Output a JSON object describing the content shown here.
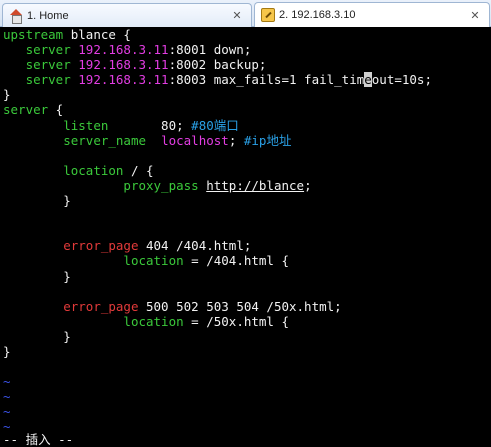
{
  "tabs": {
    "home": {
      "label": "1. Home",
      "icon": "home-icon"
    },
    "active": {
      "label": "2. 192.168.3.10",
      "icon": "key-icon"
    },
    "close_glyph": "✕"
  },
  "editor": {
    "upstream_kw": "upstream",
    "upstream_name": " blance {",
    "servers": [
      {
        "kw": "server",
        "ip": "192.168.3.11",
        "rest": ":8001 down;"
      },
      {
        "kw": "server",
        "ip": "192.168.3.11",
        "rest": ":8002 backup;"
      },
      {
        "kw": "server",
        "ip": "192.168.3.11",
        "rest_a": ":8003 max_fails=1 fail_tim",
        "cursor": "e",
        "rest_b": "out=10s;"
      }
    ],
    "close_brace": "}",
    "server_kw": "server",
    "server_open": " {",
    "listen_kw": "listen",
    "listen_value": "       80; ",
    "listen_comment": "#80端口",
    "server_name_kw": "server_name",
    "server_name_value": "localhost",
    "server_name_semicolon": "; ",
    "server_name_comment": "#ip地址",
    "location_kw": "location",
    "location_path": " / {",
    "proxy_pass_kw": "proxy_pass",
    "proxy_pass_url": "http://blance",
    "semicolon": ";",
    "inner_close": "}",
    "error_page_kw": "error_page",
    "error_404_args": " 404 /404.html;",
    "location_404": " = /404.html {",
    "error_50x_args": " 500 502 503 504 /50x.html;",
    "location_50x": " = /50x.html {",
    "tilde": "~",
    "mode_line": "-- 插入 --"
  },
  "colors": {
    "keyword": "#3bc93b",
    "ip": "#e23de2",
    "comment": "#2aa0e6",
    "error_kw": "#e23a3a",
    "tilde": "#3b52e8"
  }
}
